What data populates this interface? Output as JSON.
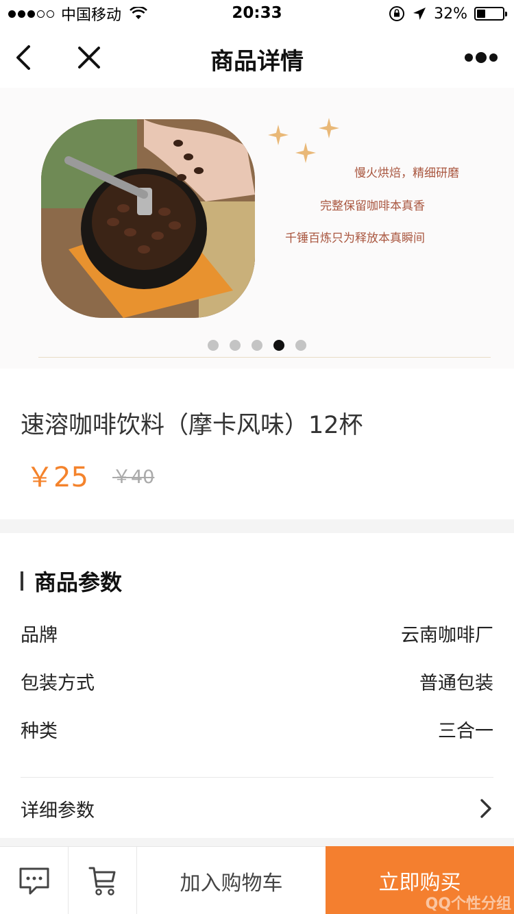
{
  "status_bar": {
    "carrier": "中国移动",
    "time": "20:33",
    "battery_percent_text": "32%",
    "battery_level": 0.32
  },
  "nav": {
    "title": "商品详情"
  },
  "banner": {
    "line1": "慢火烘焙，精细研磨",
    "line2": "完整保留咖啡本真香",
    "line3": "千锤百炼只为释放本真瞬间",
    "slide_count": 5,
    "active_slide": 4
  },
  "product": {
    "title": "速溶咖啡饮料（摩卡风味）12杯",
    "price": "￥25",
    "original_price": "￥40"
  },
  "params": {
    "heading": "商品参数",
    "rows": [
      {
        "label": "品牌",
        "value": "云南咖啡厂"
      },
      {
        "label": "包装方式",
        "value": "普通包装"
      },
      {
        "label": "种类",
        "value": "三合一"
      }
    ],
    "detail_label": "详细参数"
  },
  "bottom_bar": {
    "add_to_cart": "加入购物车",
    "buy_now": "立即购买",
    "watermark": "QQ个性分组"
  },
  "colors": {
    "accent": "#f47f2f",
    "price": "#f4832c"
  }
}
